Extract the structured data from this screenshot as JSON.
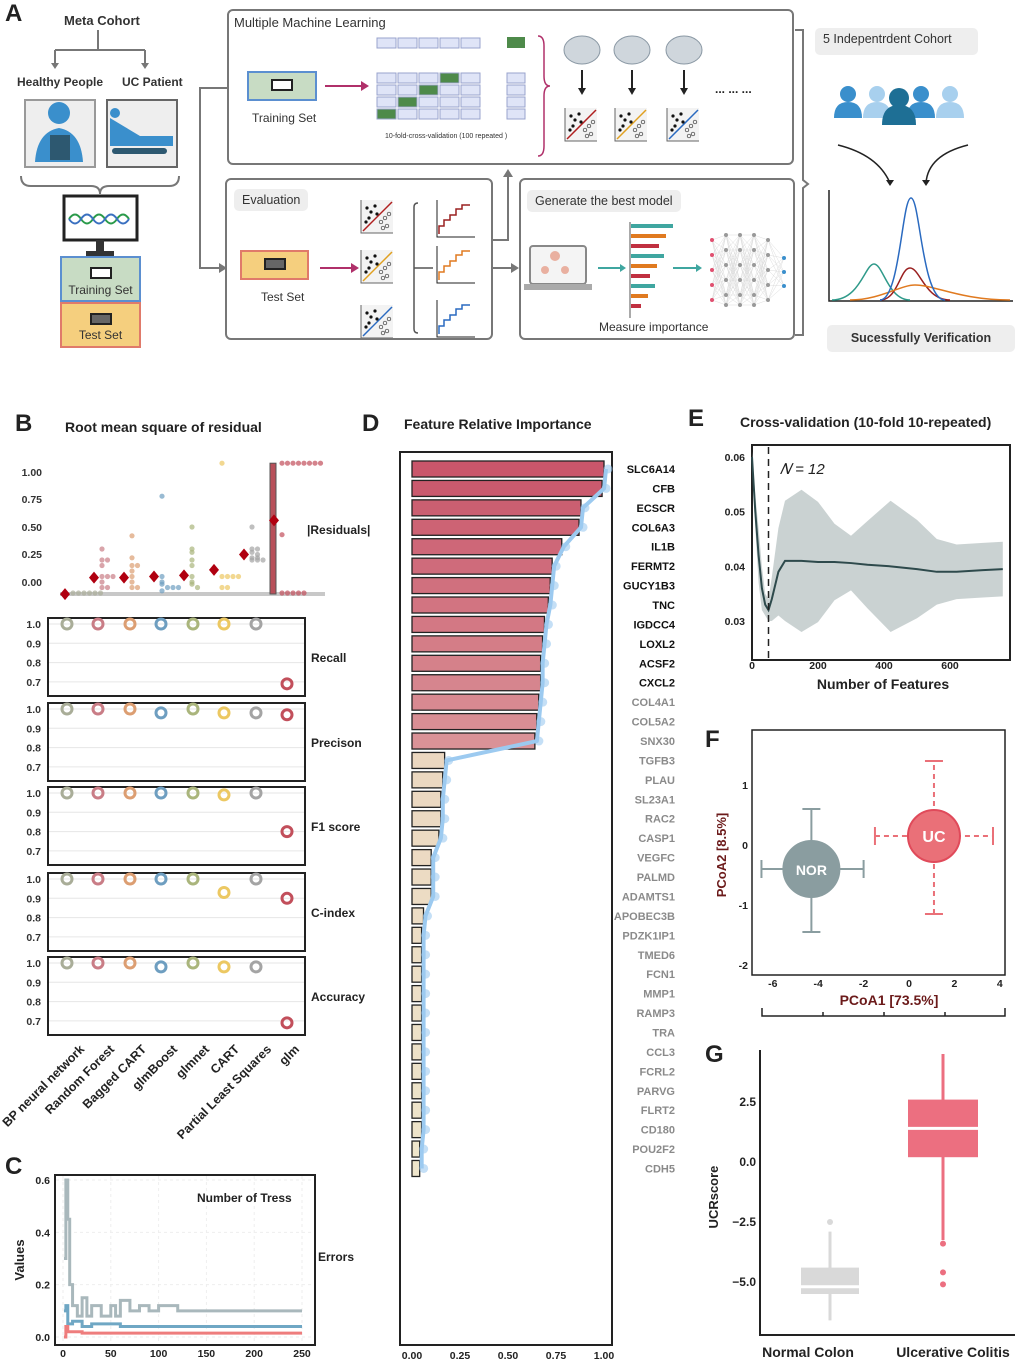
{
  "panels": {
    "a": "A",
    "b": "B",
    "c": "C",
    "d": "D",
    "e": "E",
    "f": "F",
    "g": "G"
  },
  "workflow": {
    "meta_cohort": "Meta Cohort",
    "healthy_people": "Healthy People",
    "uc_patient": "UC Patient",
    "training_set": "Training Set",
    "test_set": "Test Set",
    "mml_title": "Multiple Machine Learning",
    "cv_note": "10-fold-cross-validation  (100 repeated )",
    "ellipsis": "... ... ...",
    "evaluation": "Evaluation",
    "best_model": "Generate the best model",
    "measure_importance": "Measure importance",
    "independent_cohort": "5 Indepentrdent Cohort",
    "verification": "Sucessfully    Verification",
    "colors": {
      "training": "#c8dcc4",
      "test": "#f5cf7e",
      "fold": "#dfe4f7",
      "fold_active": "#4e8a4a",
      "arrow": "#b0306a"
    }
  },
  "chart_data": [
    {
      "id": "residuals",
      "type": "scatter",
      "title": "Root mean square of residual",
      "label": "|Residuals|",
      "yticks": [
        "1.00",
        "0.75",
        "0.50",
        "0.25",
        "0.00"
      ],
      "ylim": [
        -0.12,
        1.1
      ],
      "categories": [
        "BP neural network",
        "Random Forest",
        "Bagged CART",
        "glmBoost",
        "glmnet",
        "CART",
        "Partial Least Squares",
        "glm"
      ],
      "colors": [
        "#a9ad98",
        "#c97d86",
        "#dc9e72",
        "#6e9ec0",
        "#aab57c",
        "#ecc862",
        "#a4a4a4",
        "#c24f5b"
      ],
      "mean": [
        -0.11,
        0.04,
        0.04,
        0.05,
        0.06,
        0.11,
        0.25,
        0.56
      ],
      "points": [
        [
          -0.1,
          -0.1,
          -0.1,
          -0.1,
          -0.1,
          -0.1
        ],
        [
          0.3,
          0.2,
          0.2,
          0.15,
          0.05,
          0.05,
          0.05,
          0.0,
          -0.05,
          -0.05
        ],
        [
          0.42,
          0.22,
          0.15,
          0.15,
          0.1,
          0.05,
          0.0,
          -0.05,
          -0.05
        ],
        [
          0.78,
          0.05,
          0.0,
          -0.02,
          -0.05,
          -0.05,
          -0.05,
          -0.08
        ],
        [
          0.5,
          0.3,
          0.27,
          0.2,
          0.15,
          0.05,
          0.0,
          -0.02,
          -0.05
        ],
        [
          1.08,
          0.05,
          0.05,
          0.05,
          0.05,
          -0.05,
          -0.05
        ],
        [
          0.5,
          0.3,
          0.3,
          0.27,
          0.25,
          0.22,
          0.22,
          0.2,
          0.2,
          0.2
        ],
        [
          1.08,
          1.08,
          1.08,
          1.08,
          1.08,
          1.08,
          1.08,
          1.08,
          0.43,
          -0.1,
          -0.1,
          -0.1,
          -0.1,
          -0.1
        ]
      ]
    },
    {
      "id": "metrics",
      "type": "scatter",
      "yticks": [
        "1.0",
        "0.9",
        "0.8",
        "0.7"
      ],
      "ylim": [
        0.68,
        1.0
      ],
      "categories": [
        "BP neural network",
        "Random Forest",
        "Bagged CART",
        "glmBoost",
        "glmnet",
        "CART",
        "Partial Least Squares",
        "glm"
      ],
      "series": [
        {
          "name": "Recall",
          "values": [
            1.0,
            1.0,
            1.0,
            1.0,
            1.0,
            1.0,
            1.0,
            0.69
          ]
        },
        {
          "name": "Precison",
          "values": [
            1.0,
            1.0,
            1.0,
            0.98,
            1.0,
            0.98,
            0.98,
            0.97
          ]
        },
        {
          "name": "F1 score",
          "values": [
            1.0,
            1.0,
            1.0,
            1.0,
            1.0,
            0.99,
            1.0,
            0.8
          ]
        },
        {
          "name": "C-index",
          "values": [
            1.0,
            1.0,
            1.0,
            1.0,
            1.0,
            0.93,
            1.0,
            0.9
          ]
        },
        {
          "name": "Accuracy",
          "values": [
            1.0,
            1.0,
            1.0,
            0.98,
            1.0,
            0.98,
            0.98,
            0.69
          ]
        }
      ]
    },
    {
      "id": "errors",
      "type": "line",
      "title": "Number of Tress",
      "label": "Errors",
      "ylabel": "Values",
      "xticks": [
        "0",
        "50",
        "100",
        "150",
        "200",
        "250"
      ],
      "yticks": [
        "0.6",
        "0.4",
        "0.2",
        "0.0"
      ],
      "xlim": [
        0,
        250
      ],
      "ylim": [
        0,
        0.6
      ],
      "series": [
        {
          "color": "#a9b8bc",
          "x": [
            1,
            3,
            5,
            7,
            10,
            15,
            20,
            25,
            30,
            40,
            50,
            55,
            60,
            70,
            80,
            90,
            100,
            120,
            250
          ],
          "y": [
            0.3,
            0.6,
            0.45,
            0.2,
            0.12,
            0.08,
            0.15,
            0.08,
            0.12,
            0.08,
            0.12,
            0.08,
            0.14,
            0.1,
            0.12,
            0.1,
            0.12,
            0.1,
            0.1
          ]
        },
        {
          "color": "#6fa7c4",
          "x": [
            1,
            3,
            5,
            10,
            20,
            30,
            50,
            60,
            100,
            250
          ],
          "y": [
            0.1,
            0.12,
            0.05,
            0.06,
            0.04,
            0.05,
            0.05,
            0.04,
            0.04,
            0.04
          ]
        },
        {
          "color": "#ee7d7d",
          "x": [
            1,
            3,
            5,
            10,
            20,
            250
          ],
          "y": [
            0.0,
            0.04,
            0.02,
            0.02,
            0.015,
            0.015
          ]
        }
      ]
    },
    {
      "id": "importance",
      "type": "bar",
      "title": "Feature Relative Importance",
      "xticks": [
        "0.00",
        "0.25",
        "0.50",
        "0.75",
        "1.00"
      ],
      "xlim": [
        0,
        1
      ],
      "highlight_count": 15,
      "bold_label_count": 12,
      "colors": {
        "top": "#c9566b",
        "top_light": "#da9297",
        "rest": "#ebd7c0",
        "rest_light": "#eee6cc",
        "curve": "#9ccaf0"
      },
      "categories": [
        "SLC6A14",
        "CFB",
        "ECSCR",
        "COL6A3",
        "IL1B",
        "FERMT2",
        "GUCY1B3",
        "TNC",
        "IGDCC4",
        "LOXL2",
        "ACSF2",
        "CXCL2",
        "COL4A1",
        "COL5A2",
        "SNX30",
        "TGFB3",
        "PLAU",
        "SL23A1",
        "RAC2",
        "CASP1",
        "VEGFC",
        "PALMD",
        "ADAMTS1",
        "APOBEC3B",
        "PDZK1IP1",
        "TMED6",
        "FCN1",
        "MMP1",
        "RAMP3",
        "TRA",
        "CCL3",
        "FCRL2",
        "PARVG",
        "FLRT2",
        "CD180",
        "POU2F2",
        "CDH5"
      ],
      "values": [
        1.0,
        0.99,
        0.88,
        0.87,
        0.78,
        0.73,
        0.72,
        0.71,
        0.69,
        0.68,
        0.67,
        0.67,
        0.66,
        0.65,
        0.64,
        0.17,
        0.16,
        0.15,
        0.15,
        0.14,
        0.1,
        0.1,
        0.1,
        0.06,
        0.05,
        0.05,
        0.05,
        0.05,
        0.05,
        0.05,
        0.05,
        0.05,
        0.05,
        0.05,
        0.05,
        0.04,
        0.04
      ]
    },
    {
      "id": "cv",
      "type": "line",
      "title": "Cross-validation (10-fold 10-repeated)",
      "xlabel": "Number  of  Features",
      "annotation": "𝑁  =  12",
      "xticks": [
        "0",
        "200",
        "400",
        "600"
      ],
      "yticks": [
        "0.06",
        "0.05",
        "0.04",
        "0.03"
      ],
      "xlim": [
        0,
        770
      ],
      "ylim": [
        0.025,
        0.062
      ],
      "optimal_n": 50,
      "x": [
        0,
        10,
        20,
        30,
        40,
        50,
        60,
        80,
        100,
        150,
        200,
        250,
        300,
        350,
        420,
        500,
        560,
        620,
        700,
        760
      ],
      "y": [
        0.06,
        0.05,
        0.042,
        0.036,
        0.033,
        0.032,
        0.034,
        0.039,
        0.041,
        0.041,
        0.0408,
        0.0408,
        0.0406,
        0.0403,
        0.04,
        0.0395,
        0.039,
        0.039,
        0.0393,
        0.0395
      ],
      "ci_halfwidth": [
        0.001,
        0.003,
        0.005,
        0.004,
        0.002,
        0.002,
        0.004,
        0.008,
        0.011,
        0.013,
        0.011,
        0.007,
        0.005,
        0.008,
        0.012,
        0.009,
        0.006,
        0.005,
        0.005,
        0.005
      ]
    },
    {
      "id": "pcoa",
      "type": "scatter",
      "xlabel": "PCoA1 [73.5%]",
      "ylabel": "PCoA2 [8.5%]",
      "xticks": [
        "-6",
        "-4",
        "-2",
        "0",
        "2",
        "4"
      ],
      "yticks": [
        "1",
        "0",
        "-1",
        "-2"
      ],
      "xlim": [
        -7,
        4.2
      ],
      "ylim": [
        -2.1,
        1.2
      ],
      "groups": [
        {
          "name": "NOR",
          "x": -4.3,
          "y": -0.4,
          "x_range": [
            -6.5,
            -2.0
          ],
          "y_range": [
            -1.45,
            0.6
          ],
          "color": "#8a9da0"
        },
        {
          "name": "UC",
          "x": 1.1,
          "y": 0.15,
          "x_range": [
            -1.5,
            3.7
          ],
          "y_range": [
            -1.15,
            1.4
          ],
          "color": "#ea7078"
        }
      ]
    },
    {
      "id": "ucrscore",
      "type": "box",
      "ylabel": "UCRscore",
      "yticks": [
        "2.5",
        "0.0",
        "−2.5",
        "−5.0"
      ],
      "categories": [
        "Normal Colon",
        "Ulcerative Colitis"
      ],
      "boxes": [
        {
          "min": -6.6,
          "q1": -5.5,
          "median": -5.2,
          "q3": -4.4,
          "max": -2.9,
          "outliers": [
            -2.5
          ],
          "color": "#d9d9d9"
        },
        {
          "min": -3.25,
          "q1": 0.2,
          "median": 1.4,
          "q3": 2.6,
          "max": 4.5,
          "outliers": [
            -3.4,
            -4.6,
            -5.1
          ],
          "color": "#ec6f80"
        }
      ]
    }
  ]
}
